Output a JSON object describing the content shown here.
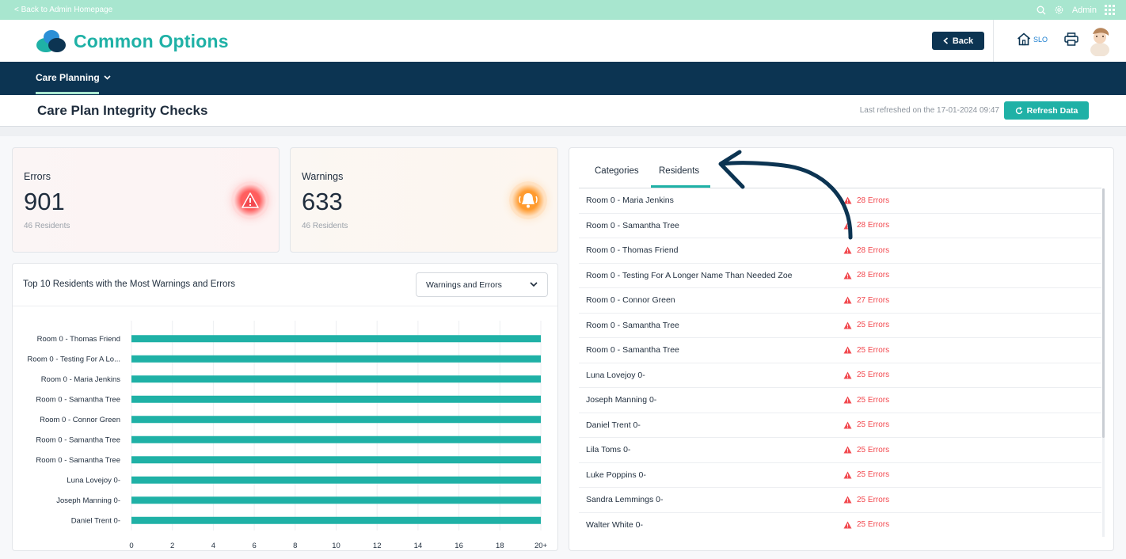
{
  "topbar": {
    "back_link": "< Back to Admin Homepage",
    "user_label": "Admin"
  },
  "header": {
    "brand": "Common Options",
    "back_button": "Back",
    "slo_label": "SLO"
  },
  "nav": {
    "item": "Care Planning"
  },
  "page": {
    "title": "Care Plan Integrity Checks",
    "last_refreshed": "Last refreshed on the 17-01-2024 09:47",
    "refresh_button": "Refresh Data"
  },
  "stats": {
    "errors": {
      "label": "Errors",
      "value": "901",
      "sub": "46 Residents"
    },
    "warnings": {
      "label": "Warnings",
      "value": "633",
      "sub": "46 Residents"
    }
  },
  "chart": {
    "title": "Top 10 Residents with the Most Warnings and Errors",
    "select_value": "Warnings and Errors"
  },
  "chart_data": {
    "type": "bar",
    "orientation": "horizontal",
    "categories": [
      "Room 0 - Thomas Friend",
      "Room 0 - Testing For A Lo...",
      "Room 0 - Maria Jenkins",
      "Room 0 - Samantha Tree",
      "Room 0 - Connor Green",
      "Room 0 - Samantha Tree",
      "Room 0 - Samantha Tree",
      "Luna Lovejoy 0-",
      "Joseph Manning 0-",
      "Daniel Trent 0-"
    ],
    "values": [
      20,
      20,
      20,
      20,
      20,
      20,
      20,
      20,
      20,
      20
    ],
    "x_ticks": [
      "0",
      "2",
      "4",
      "6",
      "8",
      "10",
      "12",
      "14",
      "16",
      "18",
      "20+"
    ],
    "xlim": [
      0,
      20
    ],
    "grid": true,
    "color": "#1fb1a6"
  },
  "tabs": [
    "Categories",
    "Residents"
  ],
  "residents": [
    {
      "name": "Room 0 - Maria Jenkins",
      "errors": "28 Errors"
    },
    {
      "name": "Room 0 - Samantha Tree",
      "errors": "28 Errors"
    },
    {
      "name": "Room 0 - Thomas Friend",
      "errors": "28 Errors"
    },
    {
      "name": "Room 0 - Testing For A Longer Name Than Needed Zoe",
      "errors": "28 Errors"
    },
    {
      "name": "Room 0 - Connor Green",
      "errors": "27 Errors"
    },
    {
      "name": "Room 0 - Samantha Tree",
      "errors": "25 Errors"
    },
    {
      "name": "Room 0 - Samantha Tree",
      "errors": "25 Errors"
    },
    {
      "name": "Luna Lovejoy 0-",
      "errors": "25 Errors"
    },
    {
      "name": "Joseph Manning 0-",
      "errors": "25 Errors"
    },
    {
      "name": "Daniel Trent 0-",
      "errors": "25 Errors"
    },
    {
      "name": "Lila Toms 0-",
      "errors": "25 Errors"
    },
    {
      "name": "Luke Poppins 0-",
      "errors": "25 Errors"
    },
    {
      "name": "Sandra Lemmings 0-",
      "errors": "25 Errors"
    },
    {
      "name": "Walter White 0-",
      "errors": "25 Errors"
    }
  ],
  "colors": {
    "accent": "#1fb1a6",
    "navy": "#0c3452",
    "mint": "#a8e6cf",
    "error": "#f2494f",
    "warning": "#ff9b2f"
  }
}
